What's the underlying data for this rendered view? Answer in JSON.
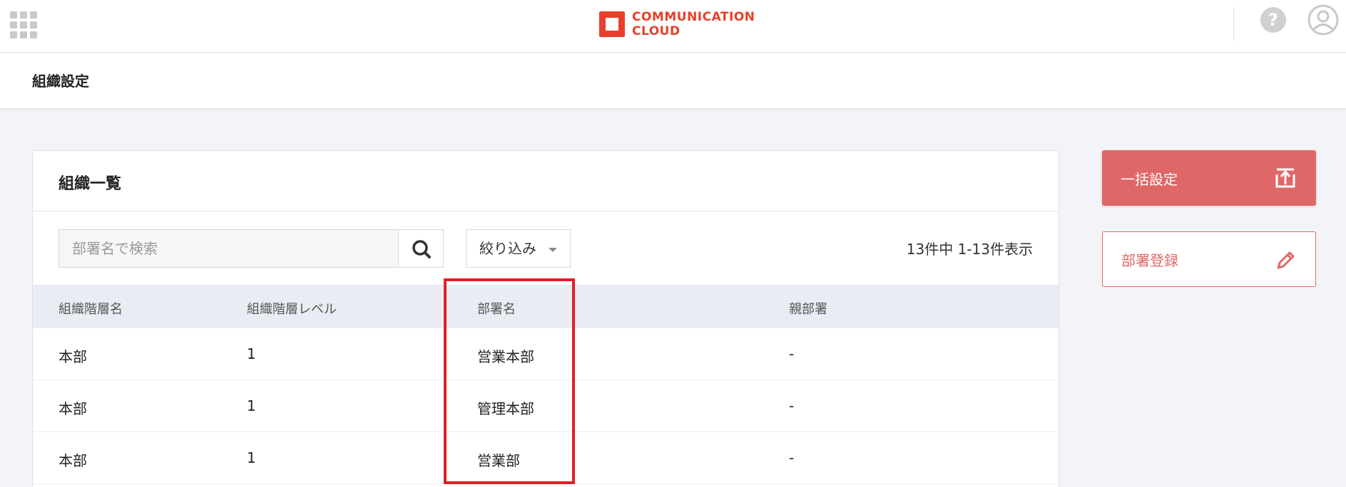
{
  "header": {
    "brand_line1": "COMMUNICATION",
    "brand_line2": "CLOUD",
    "help_glyph": "?",
    "icons": [
      "apps-grid-icon",
      "help-icon",
      "user-avatar-icon"
    ],
    "brand_color": "#e8402a"
  },
  "page": {
    "title": "組織設定"
  },
  "card": {
    "title": "組織一覧",
    "search_placeholder": "部署名で検索",
    "filter_label": "絞り込み",
    "count_text": "13件中 1-13件表示"
  },
  "table": {
    "columns": [
      "組織階層名",
      "組織階層レベル",
      "部署名",
      "親部署"
    ],
    "rows": [
      [
        "本部",
        "1",
        "営業本部",
        "-"
      ],
      [
        "本部",
        "1",
        "管理本部",
        "-"
      ],
      [
        "本部",
        "1",
        "営業部",
        "-"
      ]
    ]
  },
  "actions": {
    "bulk_label": "一括設定",
    "register_label": "部署登録",
    "accent_color": "#e06767",
    "highlight_color": "#e21f26"
  }
}
